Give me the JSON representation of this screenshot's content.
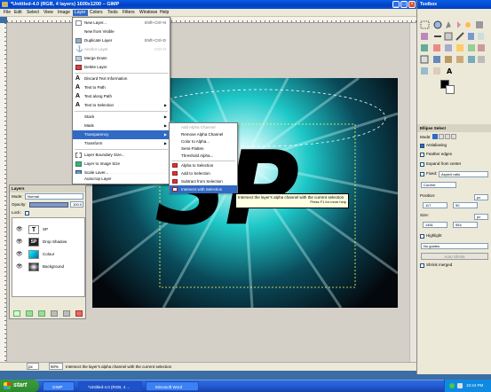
{
  "window": {
    "title": "*Untitled-4.0 (RGB, 4 layers) 1600x1200 – GIMP"
  },
  "menubar": [
    "File",
    "Edit",
    "Select",
    "View",
    "Image",
    "Layer",
    "Colors",
    "Tools",
    "Filters",
    "Windows",
    "Help"
  ],
  "layer_menu": {
    "items": [
      {
        "label": "New Layer...",
        "shortcut": "Shift+Ctrl+N",
        "disabled": false
      },
      {
        "label": "New from Visible",
        "shortcut": "",
        "disabled": false
      },
      {
        "label": "Duplicate Layer",
        "shortcut": "Shift+Ctrl+D",
        "disabled": false
      },
      {
        "label": "Anchor Layer",
        "shortcut": "Ctrl+H",
        "disabled": true
      },
      {
        "label": "Merge Down",
        "shortcut": "",
        "disabled": false
      },
      {
        "label": "Delete Layer",
        "shortcut": "",
        "disabled": false
      },
      {
        "label": "Discard Text Information",
        "shortcut": "",
        "disabled": false
      },
      {
        "label": "Text to Path",
        "shortcut": "",
        "disabled": false
      },
      {
        "label": "Text along Path",
        "shortcut": "",
        "disabled": false
      },
      {
        "label": "Text to Selection",
        "shortcut": "",
        "disabled": false
      },
      {
        "label": "Stack",
        "shortcut": "",
        "disabled": false
      },
      {
        "label": "Mask",
        "shortcut": "",
        "disabled": false
      },
      {
        "label": "Transparency",
        "shortcut": "",
        "disabled": false
      },
      {
        "label": "Transform",
        "shortcut": "",
        "disabled": false
      },
      {
        "label": "Layer Boundary Size...",
        "shortcut": "",
        "disabled": false
      },
      {
        "label": "Layer to Image Size",
        "shortcut": "",
        "disabled": false
      },
      {
        "label": "Scale Layer...",
        "shortcut": "",
        "disabled": false
      },
      {
        "label": "Crop to Selection",
        "shortcut": "",
        "disabled": false
      },
      {
        "label": "Autocrop Layer",
        "shortcut": "",
        "disabled": false
      }
    ]
  },
  "transparency_menu": {
    "items": [
      {
        "label": "Add Alpha Channel",
        "disabled": true
      },
      {
        "label": "Remove Alpha Channel",
        "disabled": false
      },
      {
        "label": "Color to Alpha...",
        "disabled": false
      },
      {
        "label": "Semi-Flatten",
        "disabled": false
      },
      {
        "label": "Threshold Alpha...",
        "disabled": false
      },
      {
        "label": "Alpha to Selection",
        "disabled": false
      },
      {
        "label": "Add to Selection",
        "disabled": false
      },
      {
        "label": "Subtract from Selection",
        "disabled": false
      },
      {
        "label": "Intersect with Selection",
        "disabled": false
      }
    ]
  },
  "tooltip": {
    "text": "Intersect the layer's alpha channel with the current selection",
    "hint": "Press F1 for more help"
  },
  "canvas_text": "SP",
  "layers_panel": {
    "title": "Layers",
    "mode_label": "Mode:",
    "mode_value": "Normal",
    "opacity_label": "Opacity:",
    "opacity_value": "100.0",
    "lock_label": "Lock:",
    "layers": [
      {
        "name": "SP",
        "kind": "text"
      },
      {
        "name": "Drop Shadow",
        "kind": "shadow"
      },
      {
        "name": "Colour",
        "kind": "colour"
      },
      {
        "name": "Background",
        "kind": "bg"
      }
    ]
  },
  "statusbar": {
    "unit": "px",
    "zoom": "50%",
    "message": "Intersect the layer's alpha channel with the current selection"
  },
  "toolbox": {
    "title": "Toolbox",
    "options_title": "Ellipse Select",
    "mode_label": "Mode:",
    "antialiasing": "Antialiasing",
    "feather": "Feather edges",
    "expand": "Expand from center",
    "fixed": "Fixed:",
    "fixed_value": "Aspect ratio",
    "current": "Current",
    "position_label": "Position:",
    "pos_unit": "px",
    "pos_x": "117",
    "pos_y": "90",
    "size_label": "Size:",
    "size_unit": "px",
    "size_w": "1461",
    "size_h": "554",
    "highlight": "Highlight",
    "guides": "No guides",
    "autoshrink": "Auto Shrink",
    "shrink_merged": "Shrink merged"
  },
  "taskbar": {
    "start": "start",
    "tasks": [
      "GIMP",
      "*Untitled-4.0 (RGB, 4 ...",
      "Microsoft Word"
    ],
    "clock": "10:44 PM"
  },
  "colors": {
    "accent": "#316ac5",
    "canvas_glow": "#1ec8c8"
  }
}
